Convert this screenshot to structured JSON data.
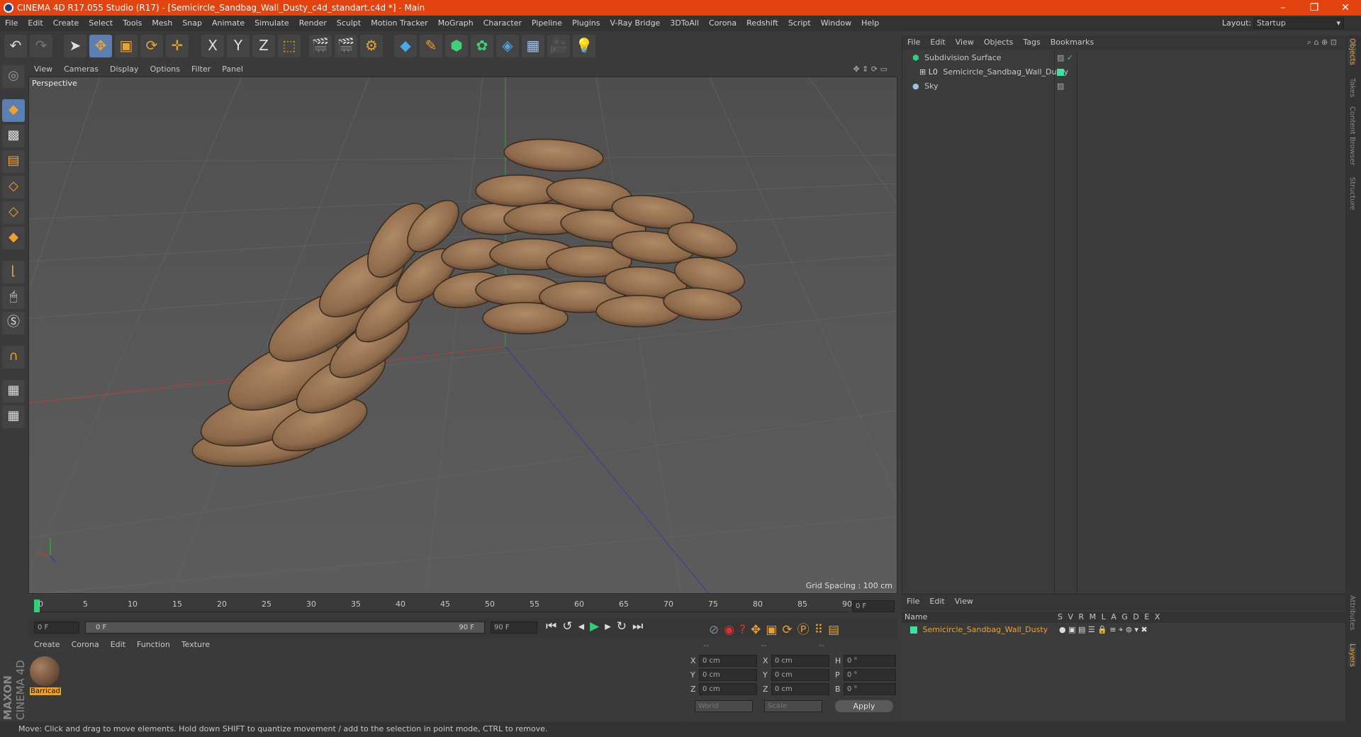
{
  "window": {
    "title": "CINEMA 4D R17.055 Studio (R17) - [Semicircle_Sandbag_Wall_Dusty_c4d_standart.c4d *] - Main"
  },
  "menu": [
    "File",
    "Edit",
    "Create",
    "Select",
    "Tools",
    "Mesh",
    "Snap",
    "Animate",
    "Simulate",
    "Render",
    "Sculpt",
    "Motion Tracker",
    "MoGraph",
    "Character",
    "Pipeline",
    "Plugins",
    "V-Ray Bridge",
    "3DToAll",
    "Corona",
    "Redshift",
    "Script",
    "Window",
    "Help"
  ],
  "layout": {
    "label": "Layout:",
    "value": "Startup"
  },
  "toolbar": {
    "x_label": "X",
    "y_label": "Y",
    "z_label": "Z"
  },
  "viewport": {
    "menu": [
      "View",
      "Cameras",
      "Display",
      "Options",
      "Filter",
      "Panel"
    ],
    "label": "Perspective",
    "grid_spacing": "Grid Spacing : 100 cm"
  },
  "timeline": {
    "ticks": [
      "0",
      "5",
      "10",
      "15",
      "20",
      "25",
      "30",
      "35",
      "40",
      "45",
      "50",
      "55",
      "60",
      "65",
      "70",
      "75",
      "80",
      "85",
      "90"
    ],
    "current_frame": "0 F",
    "start_frame": "0 F",
    "slider_start": "0 F",
    "slider_end": "90 F",
    "end_frame": "90 F"
  },
  "materials": {
    "menu": [
      "Create",
      "Corona",
      "Edit",
      "Function",
      "Texture"
    ],
    "items": [
      {
        "name": "Barricad"
      }
    ]
  },
  "coordinates": {
    "headers": [
      "--",
      "--",
      "--"
    ],
    "rows": [
      {
        "a": "X",
        "av": "0 cm",
        "b": "X",
        "bv": "0 cm",
        "c": "H",
        "cv": "0 °"
      },
      {
        "a": "Y",
        "av": "0 cm",
        "b": "Y",
        "bv": "0 cm",
        "c": "P",
        "cv": "0 °"
      },
      {
        "a": "Z",
        "av": "0 cm",
        "b": "Z",
        "bv": "0 cm",
        "c": "B",
        "cv": "0 °"
      }
    ],
    "world": "World",
    "scale": "Scale",
    "apply": "Apply"
  },
  "objects": {
    "menu": [
      "File",
      "Edit",
      "View",
      "Objects",
      "Tags",
      "Bookmarks"
    ],
    "items": [
      {
        "name": "Subdivision Surface"
      },
      {
        "name": "Semicircle_Sandbag_Wall_Dusty"
      },
      {
        "name": "Sky"
      }
    ]
  },
  "layers": {
    "menu": [
      "File",
      "Edit",
      "View"
    ],
    "columns": {
      "name": "Name",
      "flags": [
        "S",
        "V",
        "R",
        "M",
        "L",
        "A",
        "G",
        "D",
        "E",
        "X"
      ]
    },
    "rows": [
      {
        "name": "Semicircle_Sandbag_Wall_Dusty"
      }
    ]
  },
  "right_tabs": [
    "Objects",
    "Takes",
    "Content Browser",
    "Structure",
    "Attributes",
    "Layers"
  ],
  "brand": {
    "line1": "MAXON",
    "line2": "CINEMA 4D"
  },
  "status": "Move: Click and drag to move elements. Hold down SHIFT to quantize movement / add to the selection in point mode, CTRL to remove.",
  "colors": {
    "titlebar": "#e2430f",
    "accent": "#e8a232",
    "layer_green": "#3fe0a0"
  }
}
